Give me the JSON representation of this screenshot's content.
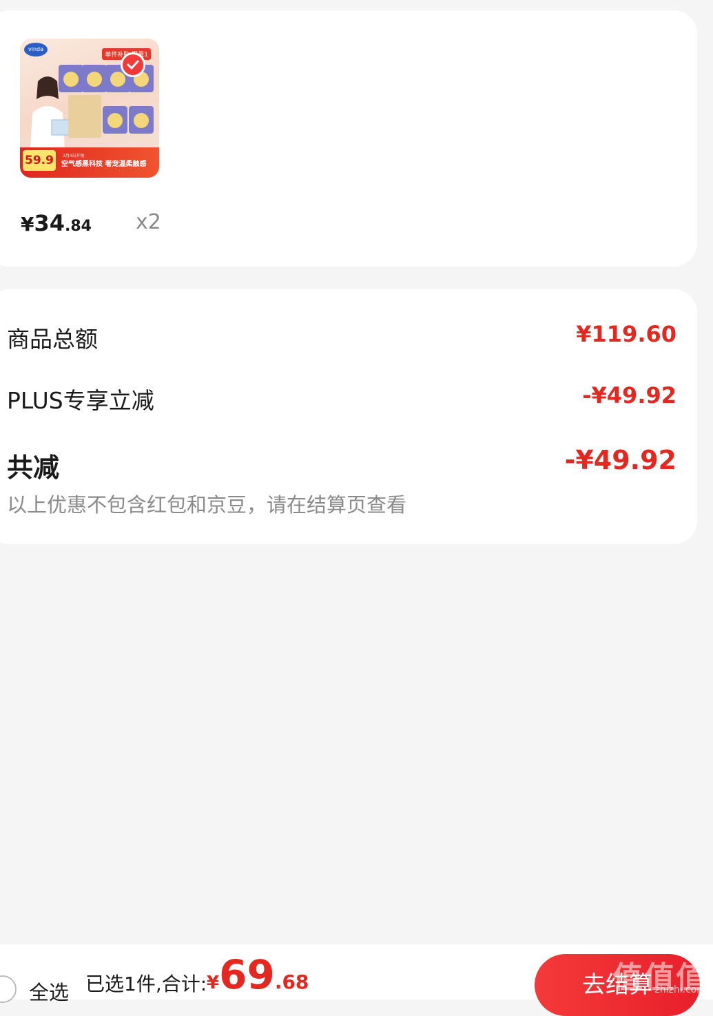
{
  "product": {
    "image_alt": "Vinda tissue product image",
    "promo_top": "单件补贴 限量1",
    "image_price": "59.9",
    "image_slogan": "空气感黑科技 奢宠温柔触感",
    "image_slogan_small": "3月4日开抢",
    "price_symbol": "¥",
    "price_int": "34",
    "price_dec": ".84",
    "quantity": "x2"
  },
  "summary": {
    "total_label": "商品总额",
    "total_value": "¥119.60",
    "plus_label": "PLUS专享立减",
    "plus_value": "-¥49.92",
    "reduce_label": "共减",
    "reduce_value": "-¥49.92",
    "note": "以上优惠不包含红包和京豆，请在结算页查看"
  },
  "bottom_bar": {
    "select_all": "全选",
    "total_label": "已选1件,合计:",
    "total_symbol": "¥",
    "total_int": "69",
    "total_dec": ".68",
    "checkout": "去结算",
    "watermark": "值值值",
    "watermark_sub": "zhizhi.com"
  },
  "colors": {
    "accent": "#e4271f",
    "background": "#f5f5f5",
    "card": "#ffffff"
  }
}
